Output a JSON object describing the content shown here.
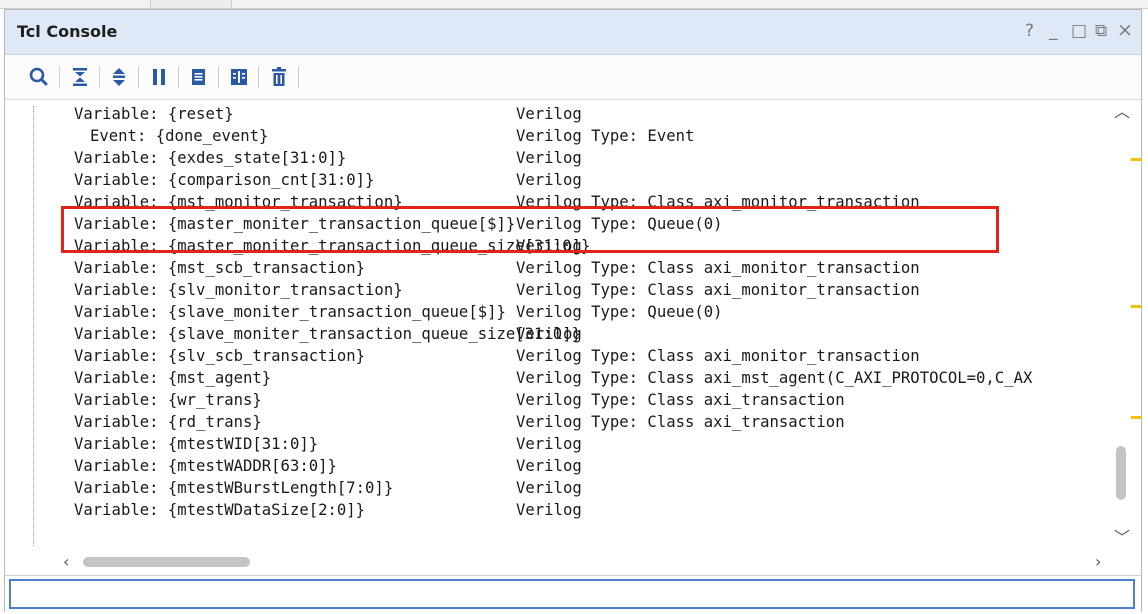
{
  "window": {
    "title": "Tcl Console",
    "controls": {
      "help": "?",
      "minimize": "_",
      "maximize": "□",
      "restore": "⧉",
      "close": "×"
    }
  },
  "toolbar": {
    "buttons": [
      "search-icon",
      "collapse-all-icon",
      "expand-all-icon",
      "pause-icon",
      "copy-icon",
      "split-columns-icon",
      "trash-icon"
    ]
  },
  "output": {
    "lines": [
      {
        "name": "{reset}",
        "prefix": "Variable:",
        "type": "Verilog"
      },
      {
        "name": "{done_event}",
        "prefix": "Event:",
        "type": "Verilog Type: Event",
        "indent": true
      },
      {
        "name": "{exdes_state[31:0]}",
        "prefix": "Variable:",
        "type": "Verilog"
      },
      {
        "name": "{comparison_cnt[31:0]}",
        "prefix": "Variable:",
        "type": "Verilog"
      },
      {
        "name": "{mst_monitor_transaction}",
        "prefix": "Variable:",
        "type": "Verilog Type: Class axi_monitor_transaction"
      },
      {
        "name": "{master_moniter_transaction_queue[$]}",
        "prefix": "Variable:",
        "type": "Verilog Type: Queue(0)"
      },
      {
        "name": "{master_moniter_transaction_queue_size[31:0]}",
        "prefix": "Variable:",
        "type": "Verilog"
      },
      {
        "name": "{mst_scb_transaction}",
        "prefix": "Variable:",
        "type": "Verilog Type: Class axi_monitor_transaction"
      },
      {
        "name": "{slv_monitor_transaction}",
        "prefix": "Variable:",
        "type": "Verilog Type: Class axi_monitor_transaction"
      },
      {
        "name": "{slave_moniter_transaction_queue[$]}",
        "prefix": "Variable:",
        "type": "Verilog Type: Queue(0)"
      },
      {
        "name": "{slave_moniter_transaction_queue_size[31:0]}",
        "prefix": "Variable:",
        "type": "Verilog"
      },
      {
        "name": "{slv_scb_transaction}",
        "prefix": "Variable:",
        "type": "Verilog Type: Class axi_monitor_transaction"
      },
      {
        "name": "{mst_agent}",
        "prefix": "Variable:",
        "type": "Verilog Type: Class axi_mst_agent(C_AXI_PROTOCOL=0,C_AX"
      },
      {
        "name": "{wr_trans}",
        "prefix": "Variable:",
        "type": "Verilog Type: Class axi_transaction"
      },
      {
        "name": "{rd_trans}",
        "prefix": "Variable:",
        "type": "Verilog Type: Class axi_transaction"
      },
      {
        "name": "{mtestWID[31:0]}",
        "prefix": "Variable:",
        "type": "Verilog"
      },
      {
        "name": "{mtestWADDR[63:0]}",
        "prefix": "Variable:",
        "type": "Verilog"
      },
      {
        "name": "{mtestWBurstLength[7:0]}",
        "prefix": "Variable:",
        "type": "Verilog"
      },
      {
        "name": "{mtestWDataSize[2:0]}",
        "prefix": "Variable:",
        "type": "Verilog"
      }
    ],
    "highlight_color": "#e2231a",
    "marker_color": "#f2c200"
  },
  "input": {
    "value": "",
    "placeholder": ""
  },
  "colors": {
    "titlebar": "#dfe8f6",
    "input_border": "#4f7fd0"
  }
}
